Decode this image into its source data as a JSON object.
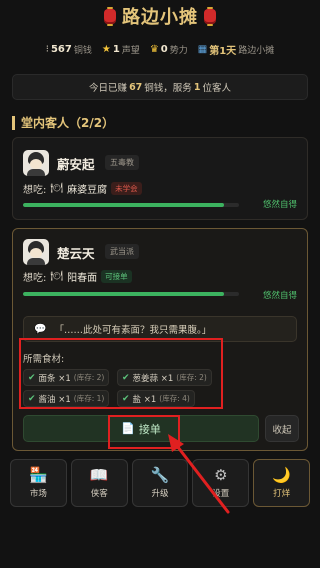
{
  "header": {
    "title": "路边小摊"
  },
  "stats": {
    "coins_value": "567",
    "coins_label": "铜钱",
    "reputation_value": "1",
    "reputation_label": "声望",
    "power_value": "0",
    "power_label": "势力",
    "day_value": "第1天",
    "day_label": "路边小摊"
  },
  "summary": {
    "prefix": "今日已赚",
    "earned": "67",
    "mid": "铜钱，服务",
    "served": "1",
    "suffix": "位客人"
  },
  "section": {
    "title": "堂内客人（2/2）"
  },
  "customers": [
    {
      "name": "蔚安起",
      "tag": "五毒教",
      "want_label": "想吃:",
      "dish": "麻婆豆腐",
      "status": "未学会",
      "mood": "悠然自得",
      "patience": 0.93
    },
    {
      "name": "楚云天",
      "tag": "武当派",
      "want_label": "想吃:",
      "dish": "阳春面",
      "status": "可接单",
      "mood": "悠然自得",
      "patience": 0.93,
      "quote": "「……此处可有素面？我只需果腹。」",
      "ingredients_title": "所需食材:",
      "ingredients": [
        {
          "name": "面条 ×1",
          "stock": "(库存: 2)"
        },
        {
          "name": "葱姜蒜 ×1",
          "stock": "(库存: 2)"
        },
        {
          "name": "酱油 ×1",
          "stock": "(库存: 1)"
        },
        {
          "name": "盐 ×1",
          "stock": "(库存: 4)"
        }
      ],
      "accept_label": "接单",
      "dismiss_label": "收起"
    }
  ],
  "nav": [
    {
      "label": "市场",
      "icon": "shop-icon"
    },
    {
      "label": "侠客",
      "icon": "book-icon"
    },
    {
      "label": "升级",
      "icon": "wrench-icon"
    },
    {
      "label": "设置",
      "icon": "gear-icon"
    },
    {
      "label": "打烊",
      "icon": "moon-icon"
    }
  ],
  "colors": {
    "accent": "#e3c47a",
    "progress": "#3cb25f",
    "highlight": "#e02020"
  }
}
